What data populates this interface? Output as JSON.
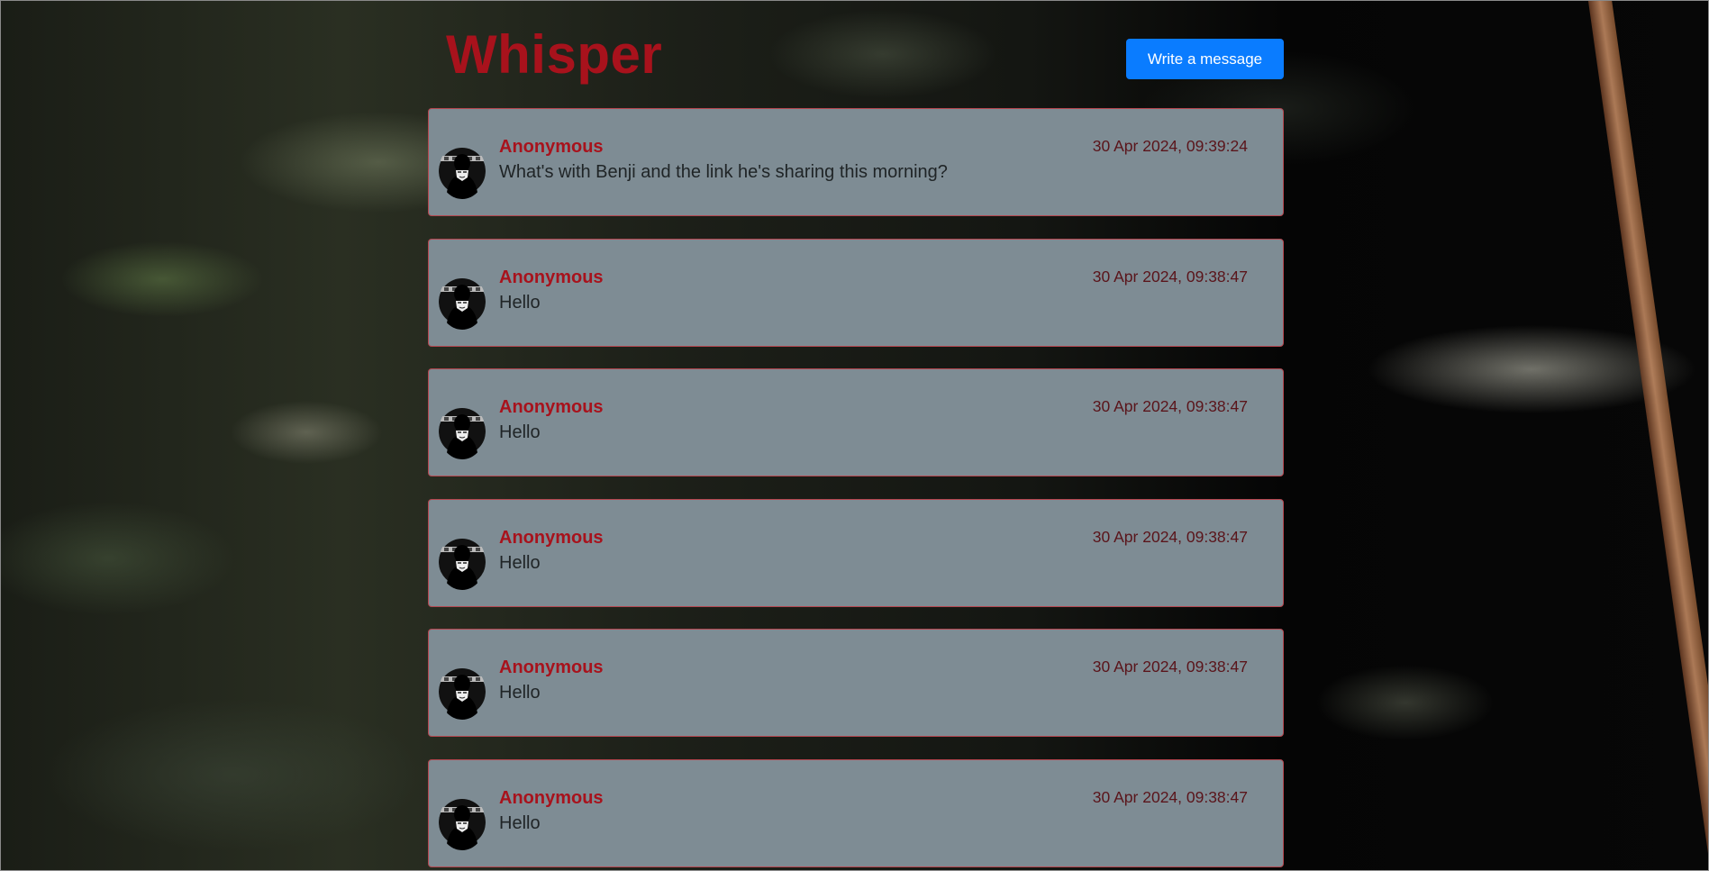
{
  "app": {
    "title": "Whisper",
    "write_button_label": "Write a message",
    "accent_color": "#a8121c",
    "button_color": "#0a7cff"
  },
  "messages": [
    {
      "author": "Anonymous",
      "timestamp": "30 Apr 2024, 09:39:24",
      "text": "What's with Benji and the link he's sharing this morning?",
      "avatar_icon": "anonymous-mask-icon"
    },
    {
      "author": "Anonymous",
      "timestamp": "30 Apr 2024, 09:38:47",
      "text": "Hello",
      "avatar_icon": "anonymous-mask-icon"
    },
    {
      "author": "Anonymous",
      "timestamp": "30 Apr 2024, 09:38:47",
      "text": "Hello",
      "avatar_icon": "anonymous-mask-icon"
    },
    {
      "author": "Anonymous",
      "timestamp": "30 Apr 2024, 09:38:47",
      "text": "Hello",
      "avatar_icon": "anonymous-mask-icon"
    },
    {
      "author": "Anonymous",
      "timestamp": "30 Apr 2024, 09:38:47",
      "text": "Hello",
      "avatar_icon": "anonymous-mask-icon"
    },
    {
      "author": "Anonymous",
      "timestamp": "30 Apr 2024, 09:38:47",
      "text": "Hello",
      "avatar_icon": "anonymous-mask-icon"
    }
  ]
}
